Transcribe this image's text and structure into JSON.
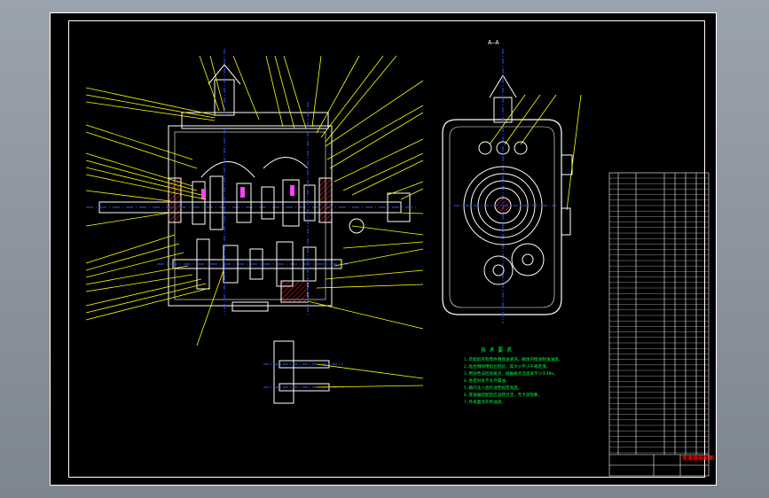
{
  "view_labels": {
    "section": "A—A"
  },
  "notes": {
    "heading": "技 术 要 求",
    "lines": [
      "1.装配前所有零件用煤油清洗，箱体内壁涂耐油油漆。",
      "2.啮合侧隙用铅丝检验，其大小不小于规定值。",
      "3.用涂色法检验斑点，接触斑点沿齿高不小于40%。",
      "4.各密封处不允许漏油。",
      "5.箱内注入齿轮油至规定高度。",
      "6.变速器装配后应运转灵活，无卡滞现象。",
      "7.外表面涂灰色油漆。"
    ]
  },
  "title_block": {
    "stamp": "变速器装配图"
  },
  "colors": {
    "outline": "#ffffff",
    "leader": "#ffff00",
    "centerline": "#3050ff",
    "hatch": "#ff2020",
    "notes": "#00ff40",
    "bolt": "#ff40ff",
    "stamp": "#ff0000"
  }
}
